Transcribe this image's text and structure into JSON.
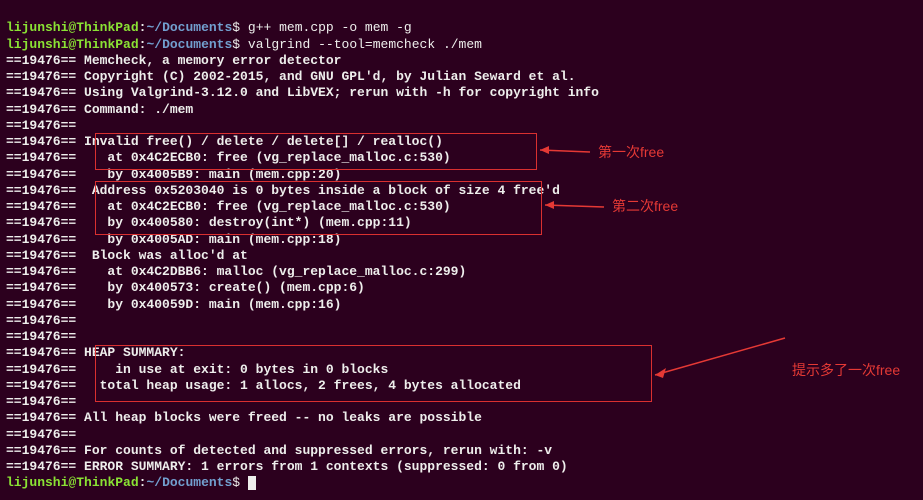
{
  "prompt": {
    "user": "lijunshi",
    "at": "@",
    "host": "ThinkPad",
    "colon": ":",
    "path": "~/Documents",
    "dollar": "$"
  },
  "cmd1": " g++ mem.cpp -o mem -g",
  "cmd2": " valgrind --tool=memcheck ./mem",
  "lines": {
    "l00": "==19476== Memcheck, a memory error detector",
    "l01": "==19476== Copyright (C) 2002-2015, and GNU GPL'd, by Julian Seward et al.",
    "l02": "==19476== Using Valgrind-3.12.0 and LibVEX; rerun with -h for copyright info",
    "l03": "==19476== Command: ./mem",
    "l04": "==19476==",
    "l05": "==19476== Invalid free() / delete / delete[] / realloc()",
    "l06": "==19476==    at 0x4C2ECB0: free (vg_replace_malloc.c:530)",
    "l07": "==19476==    by 0x4005B9: main (mem.cpp:20)",
    "l08": "==19476==  Address 0x5203040 is 0 bytes inside a block of size 4 free'd",
    "l09": "==19476==    at 0x4C2ECB0: free (vg_replace_malloc.c:530)",
    "l10": "==19476==    by 0x400580: destroy(int*) (mem.cpp:11)",
    "l11": "==19476==    by 0x4005AD: main (mem.cpp:18)",
    "l12": "==19476==  Block was alloc'd at",
    "l13": "==19476==    at 0x4C2DBB6: malloc (vg_replace_malloc.c:299)",
    "l14": "==19476==    by 0x400573: create() (mem.cpp:6)",
    "l15": "==19476==    by 0x40059D: main (mem.cpp:16)",
    "l16": "==19476==",
    "l17": "==19476==",
    "l18": "==19476== HEAP SUMMARY:",
    "l19": "==19476==     in use at exit: 0 bytes in 0 blocks",
    "l20": "==19476==   total heap usage: 1 allocs, 2 frees, 4 bytes allocated",
    "l21": "==19476==",
    "l22": "==19476== All heap blocks were freed -- no leaks are possible",
    "l23": "==19476==",
    "l24": "==19476== For counts of detected and suppressed errors, rerun with: -v",
    "l25": "==19476== ERROR SUMMARY: 1 errors from 1 contexts (suppressed: 0 from 0)"
  },
  "annotations": {
    "a1": "第一次free",
    "a2": "第二次free",
    "a3": "提示多了一次free"
  }
}
